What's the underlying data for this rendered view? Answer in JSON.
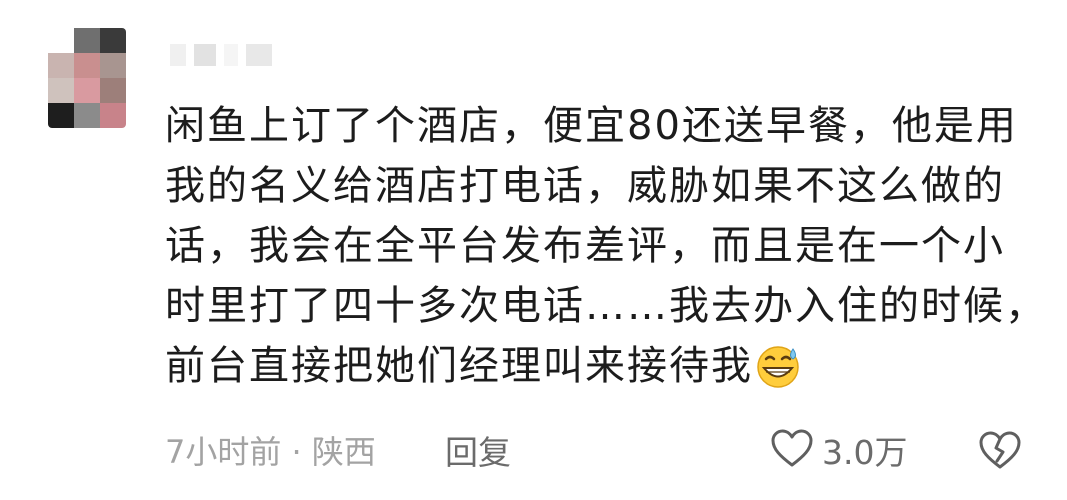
{
  "comment": {
    "lines": [
      "闲鱼上订了个酒店，便宜80还送早餐，他是用",
      "我的名义给酒店打电话，威胁如果不这么做的",
      "话，我会在全平台发布差评，而且是在一个小",
      "时里打了四十多次电话……我去办入住的时候，",
      "前台直接把她们经理叫来接待我"
    ],
    "emoji": "grinning-sweat-emoji",
    "meta": "7小时前 · 陕西",
    "reply_label": "回复",
    "like_count": "3.0万",
    "icons": {
      "like": "heart-outline-icon",
      "dislike": "broken-heart-icon"
    },
    "colors": {
      "text": "#1c1c1c",
      "meta": "#a3a3a3",
      "action": "#6b6b6b"
    }
  }
}
